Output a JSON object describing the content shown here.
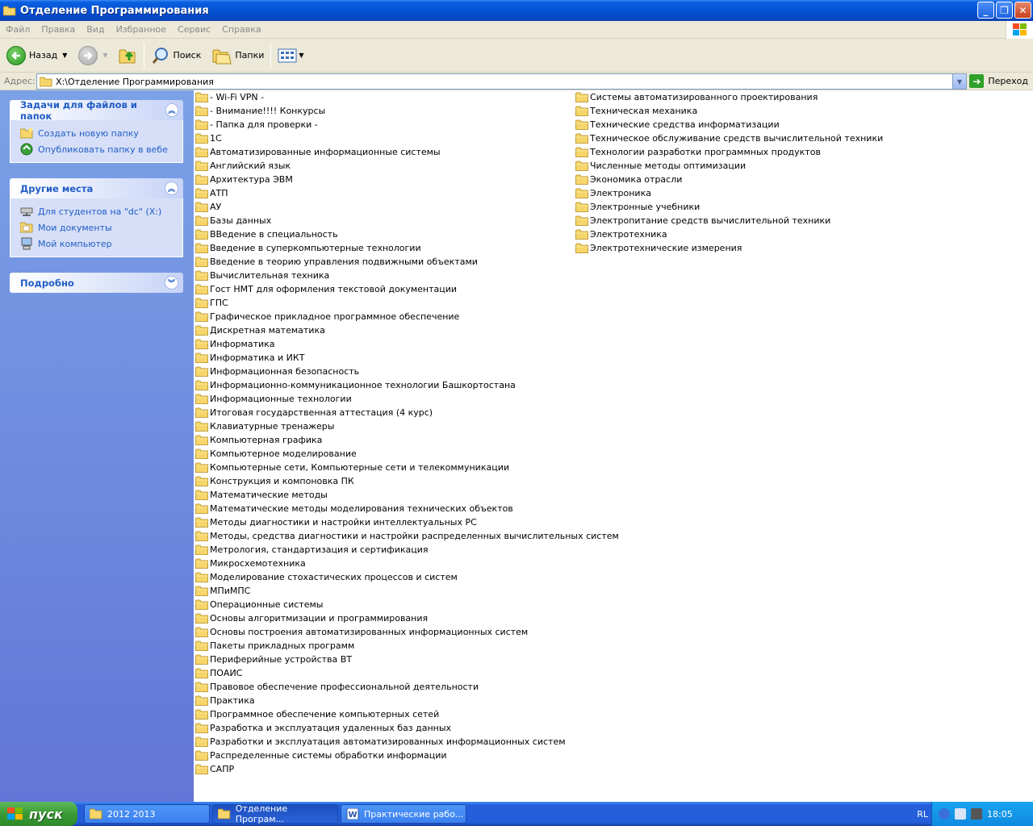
{
  "window": {
    "title": "Отделение Программирования",
    "buttons": [
      "_",
      "❐",
      "✕"
    ]
  },
  "menu": [
    "Файл",
    "Правка",
    "Вид",
    "Избранное",
    "Сервис",
    "Справка"
  ],
  "toolbar": {
    "back": "Назад",
    "search": "Поиск",
    "folders": "Папки"
  },
  "address": {
    "label": "Адрес:",
    "value": "X:\\Отделение Программирования",
    "go": "Переход"
  },
  "tasks_panel": {
    "title": "Задачи для файлов и папок",
    "items": [
      "Создать новую папку",
      "Опубликовать папку в вебе"
    ]
  },
  "places_panel": {
    "title": "Другие места",
    "items": [
      "Для студентов на \"dc\" (X:)",
      "Мои документы",
      "Мой компьютер"
    ]
  },
  "details_panel": {
    "title": "Подробно"
  },
  "folders_col1": [
    "- Wi-Fi VPN -",
    "- Внимание!!!! Конкурсы",
    "- Папка для проверки -",
    "1С",
    "Автоматизированные информационные системы",
    "Английский язык",
    "Архитектура ЭВМ",
    "АТП",
    "АУ",
    "Базы данных",
    "ВВедение в специальность",
    "Введение в суперкомпьютерные технологии",
    "Введение в теорию управления подвижными объектами",
    "Вычислительная техника",
    "Гост НМТ для оформления текстовой документации",
    "ГПС",
    "Графическое прикладное программное обеспечение",
    "Дискретная математика",
    "Информатика",
    "Информатика и ИКТ",
    "Информационная безопасность",
    "Информационно-коммуникационное технологии Башкортостана",
    "Информационные технологии",
    "Итоговая государственная аттестация (4 курс)",
    "Клавиатурные тренажеры",
    "Компьютерная графика",
    "Компьютерное моделирование",
    "Компьютерные сети, Компьютерные сети и телекоммуникации",
    "Конструкция и компоновка ПК",
    "Математические методы",
    "Математические методы моделирования технических объектов",
    "Методы диагностики и настройки интеллектуальных РС",
    "Методы, средства диагностики и настройки распределенных вычислительных систем",
    "Метрология, стандартизация и сертификация",
    "Микросхемотехника",
    "Моделирование стохастических процессов и систем",
    "МПиМПС",
    "Операционные системы",
    "Основы алгоритмизации и программирования",
    "Основы построения автоматизированных информационных систем",
    "Пакеты прикладных программ",
    "Периферийные устройства ВТ",
    "ПОАИС",
    "Правовое обеспечение профессиональной деятельности",
    "Практика",
    "Программное обеспечение компьютерных сетей",
    "Разработка и эксплуатация удаленных баз данных",
    "Разработки и эксплуатация автоматизированных информационных систем",
    "Распределенные системы обработки информации",
    "САПР"
  ],
  "folders_col2": [
    "Системы автоматизированного проектирования",
    "Техническая механика",
    "Технические средства информатизации",
    "Техническое обслуживание средств вычислительной техники",
    "Технологии разработки программных продуктов",
    "Численные методы оптимизации",
    "Экономика отрасли",
    "Электроника",
    "Электронные учебники",
    "Электропитание средств вычислительной техники",
    "Электротехника",
    "Электротехнические измерения"
  ],
  "taskbar": {
    "start": "пуск",
    "tasks": [
      "2012 2013",
      "Отделение Програм...",
      "Практические рабо..."
    ],
    "lang": "RL",
    "clock": "18:05"
  }
}
